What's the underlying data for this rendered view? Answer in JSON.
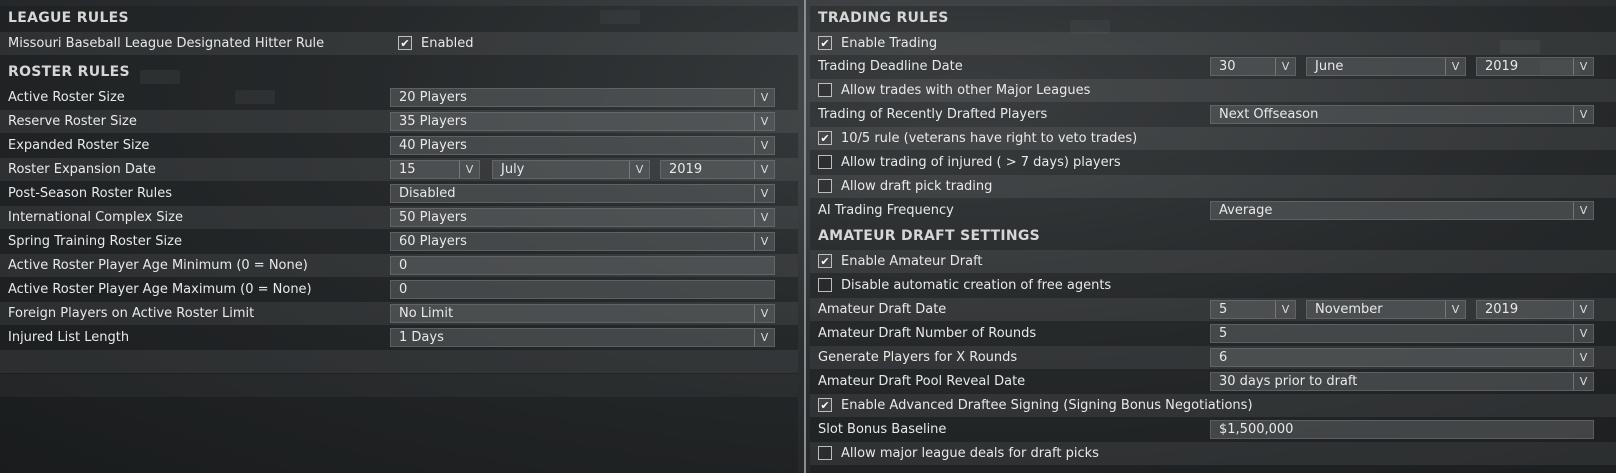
{
  "league_rules": {
    "header": "LEAGUE RULES",
    "dh_rule": {
      "label": "Missouri Baseball League Designated Hitter Rule",
      "checkbox_label": "Enabled",
      "checked": true
    }
  },
  "roster_rules": {
    "header": "ROSTER RULES",
    "active_roster": {
      "label": "Active Roster Size",
      "value": "20 Players"
    },
    "reserve_roster": {
      "label": "Reserve Roster Size",
      "value": "35 Players"
    },
    "expanded_roster": {
      "label": "Expanded Roster Size",
      "value": "40 Players"
    },
    "expansion_date": {
      "label": "Roster Expansion Date",
      "day": "15",
      "month": "July",
      "year": "2019"
    },
    "postseason_rules": {
      "label": "Post-Season Roster Rules",
      "value": "Disabled"
    },
    "intl_complex": {
      "label": "International Complex Size",
      "value": "50 Players"
    },
    "spring_training": {
      "label": "Spring Training Roster Size",
      "value": "60 Players"
    },
    "age_min": {
      "label": "Active Roster Player Age Minimum (0 = None)",
      "value": "0"
    },
    "age_max": {
      "label": "Active Roster Player Age Maximum (0 = None)",
      "value": "0"
    },
    "foreign_limit": {
      "label": "Foreign Players on Active Roster Limit",
      "value": "No Limit"
    },
    "injured_list": {
      "label": "Injured List Length",
      "value": "1 Days"
    }
  },
  "trading_rules": {
    "header": "TRADING RULES",
    "enable_trading": {
      "label": "Enable Trading",
      "checked": true
    },
    "deadline": {
      "label": "Trading Deadline Date",
      "day": "30",
      "month": "June",
      "year": "2019"
    },
    "other_leagues": {
      "label": "Allow trades with other Major Leagues",
      "checked": false
    },
    "recently_drafted": {
      "label": "Trading of Recently Drafted Players",
      "value": "Next Offseason"
    },
    "ten_five": {
      "label": "10/5 rule (veterans have right to veto trades)",
      "checked": true
    },
    "injured_trading": {
      "label": "Allow trading of injured ( > 7 days) players",
      "checked": false
    },
    "draft_pick_trading": {
      "label": "Allow draft pick trading",
      "checked": false
    },
    "ai_frequency": {
      "label": "AI Trading Frequency",
      "value": "Average"
    }
  },
  "amateur_draft": {
    "header": "AMATEUR DRAFT SETTINGS",
    "enable_draft": {
      "label": "Enable Amateur Draft",
      "checked": true
    },
    "disable_free_agents": {
      "label": "Disable automatic creation of free agents",
      "checked": false
    },
    "draft_date": {
      "label": "Amateur Draft Date",
      "day": "5",
      "month": "November",
      "year": "2019"
    },
    "rounds": {
      "label": "Amateur Draft Number of Rounds",
      "value": "5"
    },
    "generate_rounds": {
      "label": "Generate Players for X Rounds",
      "value": "6"
    },
    "pool_reveal": {
      "label": "Amateur Draft Pool Reveal Date",
      "value": "30 days prior to draft"
    },
    "advanced_signing": {
      "label": "Enable Advanced Draftee Signing (Signing Bonus Negotiations)",
      "checked": true
    },
    "slot_bonus": {
      "label": "Slot Bonus Baseline",
      "value": "$1,500,000"
    },
    "major_league_deals": {
      "label": "Allow major league deals for draft picks",
      "checked": false
    }
  },
  "icons": {
    "checkmark": "✔",
    "dropdown_arrow": "V"
  }
}
